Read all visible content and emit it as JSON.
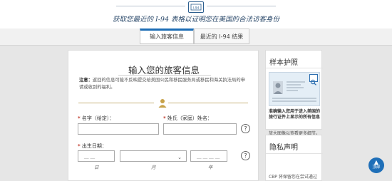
{
  "header": {
    "logo_text": "I-94",
    "tagline": "获取您最近的 I-94 表格以证明您在美国的合法访客身份"
  },
  "tabs": [
    {
      "label": "输入旅客信息",
      "active": true
    },
    {
      "label": "最近的 I-94 结果",
      "active": false
    }
  ],
  "form": {
    "title": "输入您的旅客信息",
    "notice_label": "注意：",
    "notice_text": "返回的信息可能不反映提交给美国公民和移民服务局或移民和海关执法局的申请或收到的福利。",
    "first_name_label": "名字（给定）：",
    "last_name_label": "姓氏（家庭）姓名：",
    "dob_label": "出生日期：",
    "day_placeholder": "__ __",
    "year_placeholder": "__ __ __ __",
    "day_sublabel": "日",
    "month_sublabel": "月",
    "year_sublabel": "年",
    "required_marker": "*",
    "help_glyph": "?"
  },
  "sidebar": {
    "passport_title": "样本护照",
    "passport_strong": "准确输入您用于进入美国的旅行证件上显示的所有信息",
    "passport_hint": "放大图像以查看更多细节。",
    "privacy_title": "隐私声明",
    "privacy_text": "CBP 将保留您在尝试通过"
  },
  "back_to_top": {
    "arrow": "▲",
    "label": "顶部"
  },
  "colors": {
    "accent": "#1f6fb8",
    "divider_gold": "#c7b27a",
    "required": "#c0392b"
  }
}
